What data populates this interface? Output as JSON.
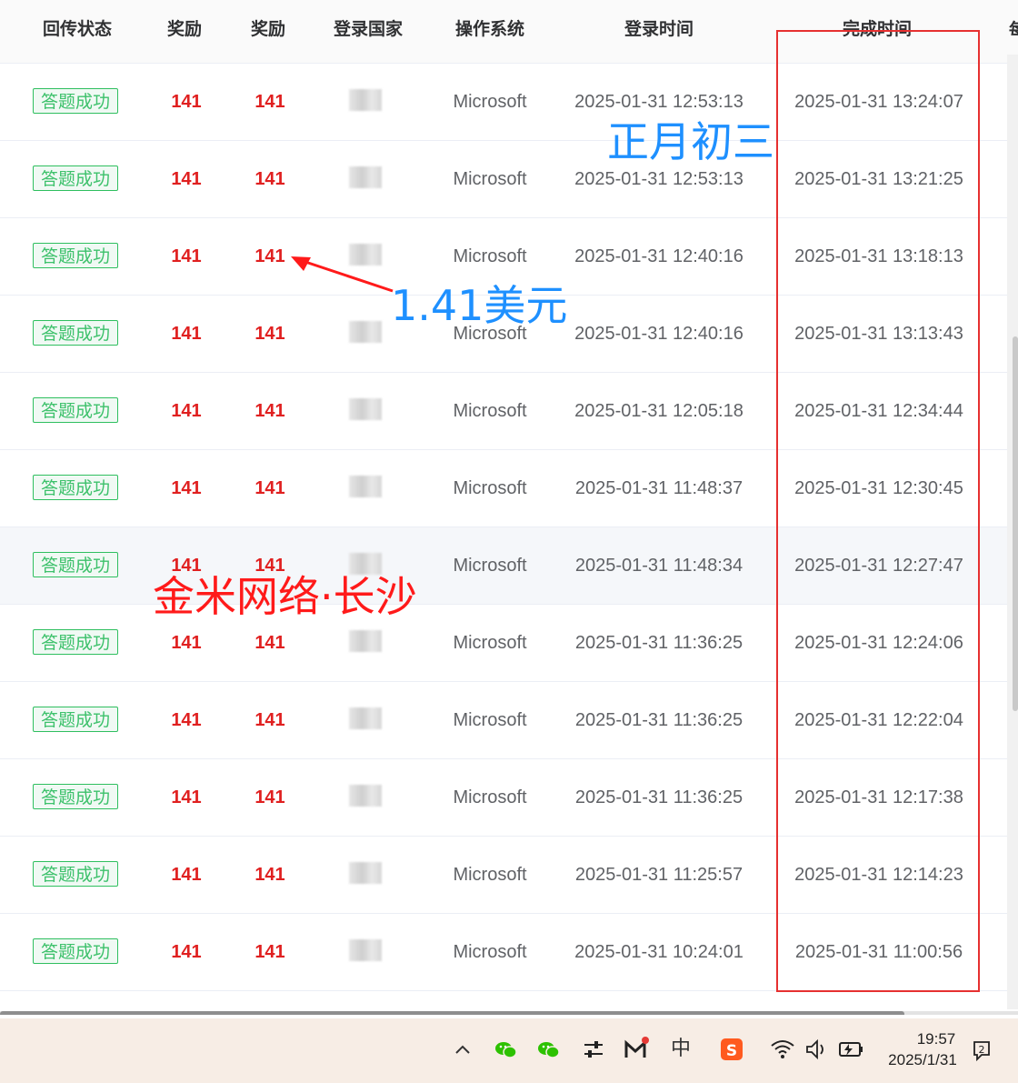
{
  "table": {
    "headers": [
      "回传状态",
      "奖励",
      "奖励",
      "登录国家",
      "操作系统",
      "登录时间",
      "完成时间"
    ],
    "cut_header": "每",
    "rows": [
      {
        "status": "答题成功",
        "reward1": "141",
        "reward2": "141",
        "os": "Microsoft",
        "login_time": "2025-01-31 12:53:13",
        "finish_time": "2025-01-31 13:24:07"
      },
      {
        "status": "答题成功",
        "reward1": "141",
        "reward2": "141",
        "os": "Microsoft",
        "login_time": "2025-01-31 12:53:13",
        "finish_time": "2025-01-31 13:21:25"
      },
      {
        "status": "答题成功",
        "reward1": "141",
        "reward2": "141",
        "os": "Microsoft",
        "login_time": "2025-01-31 12:40:16",
        "finish_time": "2025-01-31 13:18:13"
      },
      {
        "status": "答题成功",
        "reward1": "141",
        "reward2": "141",
        "os": "Microsoft",
        "login_time": "2025-01-31 12:40:16",
        "finish_time": "2025-01-31 13:13:43"
      },
      {
        "status": "答题成功",
        "reward1": "141",
        "reward2": "141",
        "os": "Microsoft",
        "login_time": "2025-01-31 12:05:18",
        "finish_time": "2025-01-31 12:34:44"
      },
      {
        "status": "答题成功",
        "reward1": "141",
        "reward2": "141",
        "os": "Microsoft",
        "login_time": "2025-01-31 11:48:37",
        "finish_time": "2025-01-31 12:30:45"
      },
      {
        "status": "答题成功",
        "reward1": "141",
        "reward2": "141",
        "os": "Microsoft",
        "login_time": "2025-01-31 11:48:34",
        "finish_time": "2025-01-31 12:27:47"
      },
      {
        "status": "答题成功",
        "reward1": "141",
        "reward2": "141",
        "os": "Microsoft",
        "login_time": "2025-01-31 11:36:25",
        "finish_time": "2025-01-31 12:24:06"
      },
      {
        "status": "答题成功",
        "reward1": "141",
        "reward2": "141",
        "os": "Microsoft",
        "login_time": "2025-01-31 11:36:25",
        "finish_time": "2025-01-31 12:22:04"
      },
      {
        "status": "答题成功",
        "reward1": "141",
        "reward2": "141",
        "os": "Microsoft",
        "login_time": "2025-01-31 11:36:25",
        "finish_time": "2025-01-31 12:17:38"
      },
      {
        "status": "答题成功",
        "reward1": "141",
        "reward2": "141",
        "os": "Microsoft",
        "login_time": "2025-01-31 11:25:57",
        "finish_time": "2025-01-31 12:14:23"
      },
      {
        "status": "答题成功",
        "reward1": "141",
        "reward2": "141",
        "os": "Microsoft",
        "login_time": "2025-01-31 10:24:01",
        "finish_time": "2025-01-31 11:00:56"
      }
    ]
  },
  "annotations": {
    "date_note": "正月初三",
    "amount_note": "1.41美元",
    "watermark": "金米网络·长沙"
  },
  "colors": {
    "reward": "#e02020",
    "badge_text": "#3dc16b",
    "annotation_blue": "#1e90ff",
    "annotation_red": "#ff1a1a",
    "highlight_box": "#e63030"
  },
  "taskbar": {
    "icons": [
      "chevron-up-icon",
      "wechat-icon",
      "wechat-icon",
      "settings-sliders-icon",
      "gmail-icon",
      "ime-chinese-icon",
      "sogou-icon",
      "wifi-icon",
      "volume-icon",
      "battery-icon",
      "notification-icon"
    ],
    "ime_label": "中",
    "time": "19:57",
    "date": "2025/1/31"
  }
}
